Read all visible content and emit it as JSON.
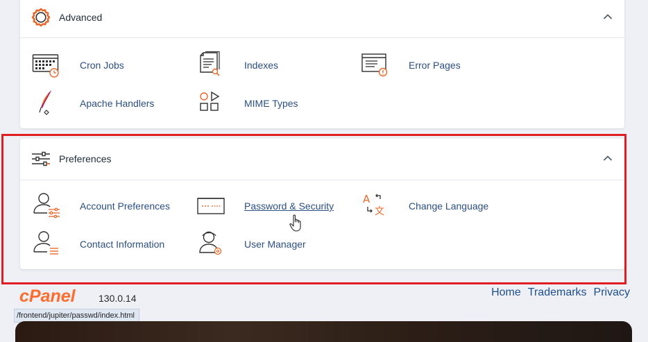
{
  "advanced": {
    "title": "Advanced",
    "items": [
      {
        "label": "Cron Jobs",
        "icon": "cron-jobs-icon"
      },
      {
        "label": "Indexes",
        "icon": "indexes-icon"
      },
      {
        "label": "Error Pages",
        "icon": "error-pages-icon"
      },
      {
        "label": "Apache Handlers",
        "icon": "apache-handlers-icon"
      },
      {
        "label": "MIME Types",
        "icon": "mime-types-icon"
      }
    ]
  },
  "preferences": {
    "title": "Preferences",
    "items": [
      {
        "label": "Account Preferences",
        "icon": "account-preferences-icon"
      },
      {
        "label": "Password & Security",
        "icon": "password-security-icon"
      },
      {
        "label": "Change Language",
        "icon": "change-language-icon"
      },
      {
        "label": "Contact Information",
        "icon": "contact-information-icon"
      },
      {
        "label": "User Manager",
        "icon": "user-manager-icon"
      }
    ]
  },
  "footer": {
    "logo_text": "cPanel",
    "version": "130.0.14",
    "links": [
      "Home",
      "Trademarks",
      "Privacy"
    ]
  },
  "status_bar": {
    "url": "/frontend/jupiter/passwd/index.html"
  },
  "colors": {
    "accent_orange": "#e8682a",
    "link_blue": "#2b4f80",
    "highlight_red": "#e11d24"
  }
}
